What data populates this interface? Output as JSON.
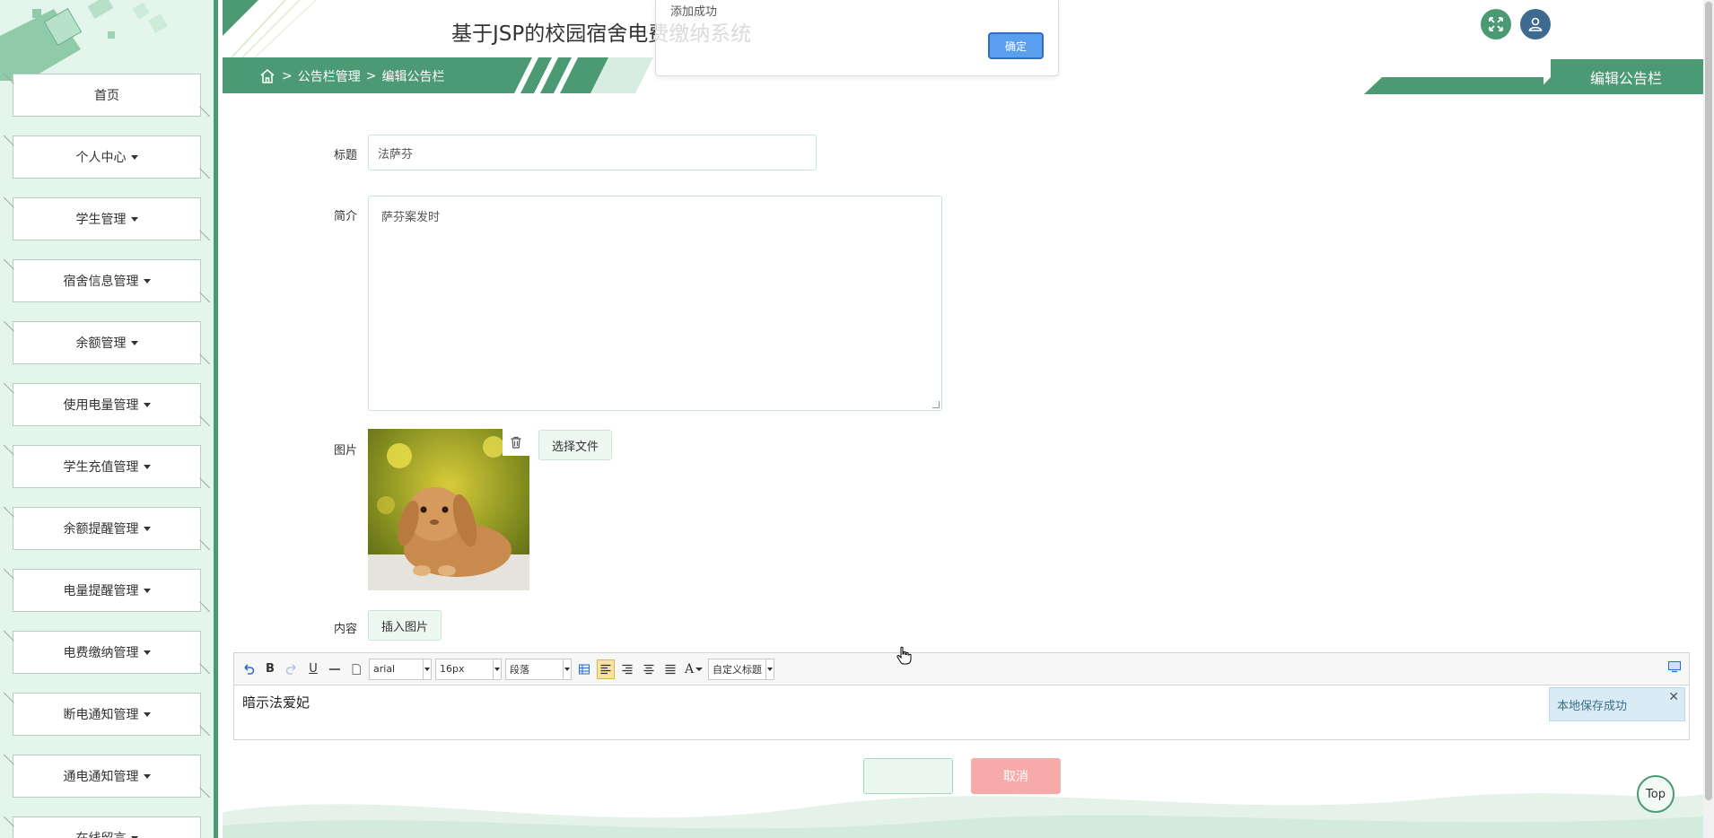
{
  "header": {
    "title": "基于JSP的校园宿舍电费缴纳系统",
    "fullscreen_icon": "fullscreen-icon",
    "user_icon": "user-icon"
  },
  "sidebar": {
    "items": [
      {
        "label": "首页",
        "dropdown": false
      },
      {
        "label": "个人中心",
        "dropdown": true
      },
      {
        "label": "学生管理",
        "dropdown": true
      },
      {
        "label": "宿舍信息管理",
        "dropdown": true
      },
      {
        "label": "余额管理",
        "dropdown": true
      },
      {
        "label": "使用电量管理",
        "dropdown": true
      },
      {
        "label": "学生充值管理",
        "dropdown": true
      },
      {
        "label": "余额提醒管理",
        "dropdown": true
      },
      {
        "label": "电量提醒管理",
        "dropdown": true
      },
      {
        "label": "电费缴纳管理",
        "dropdown": true
      },
      {
        "label": "断电通知管理",
        "dropdown": true
      },
      {
        "label": "通电通知管理",
        "dropdown": true
      },
      {
        "label": "在线留言",
        "dropdown": true
      }
    ]
  },
  "breadcrumb": {
    "home_icon": "home-icon",
    "items": [
      "公告栏管理",
      "编辑公告栏"
    ],
    "separator": ">"
  },
  "page_title": "编辑公告栏",
  "form": {
    "title_label": "标题",
    "title_value": "法萨芬",
    "intro_label": "简介",
    "intro_value": "萨芬案发时",
    "image_label": "图片",
    "choose_file_label": "选择文件",
    "content_label": "内容",
    "insert_image_label": "插入图片"
  },
  "editor": {
    "font_family": "arial",
    "font_size": "16px",
    "paragraph": "段落",
    "custom_heading": "自定义标题",
    "content": "暗示法爱妃",
    "local_save_msg": "本地保存成功"
  },
  "buttons": {
    "submit_label": "",
    "cancel_label": "取消",
    "top_label": "Top"
  },
  "dialog": {
    "message": "添加成功",
    "ok_label": "确定"
  },
  "colors": {
    "primary": "#4c9a73",
    "sidebar_bg": "#e4f5ec",
    "cancel": "#f7aaaa",
    "dialog_ok": "#5a9ef0"
  }
}
